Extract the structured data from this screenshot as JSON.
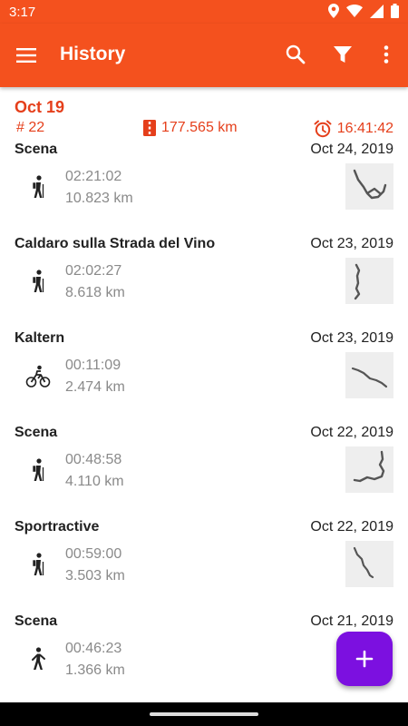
{
  "status_bar": {
    "time": "3:17",
    "icons": [
      "location-icon",
      "wifi-icon",
      "signal-icon",
      "battery-icon"
    ]
  },
  "app_bar": {
    "title": "History",
    "icons": [
      "menu-icon",
      "search-icon",
      "filter-icon",
      "more-vert-icon"
    ]
  },
  "summary": {
    "month": "Oct 19",
    "count_label": "# 22",
    "distance": "177.565 km",
    "duration": "16:41:42"
  },
  "activities": [
    {
      "name": "Scena",
      "date": "Oct 24, 2019",
      "duration": "02:21:02",
      "distance": "10.823 km",
      "type": "hiking-icon"
    },
    {
      "name": "Caldaro sulla Strada del Vino",
      "date": "Oct 23, 2019",
      "duration": "02:02:27",
      "distance": "8.618 km",
      "type": "hiking-icon"
    },
    {
      "name": "Kaltern",
      "date": "Oct 23, 2019",
      "duration": "00:11:09",
      "distance": "2.474 km",
      "type": "cycling-icon"
    },
    {
      "name": "Scena",
      "date": "Oct 22, 2019",
      "duration": "00:48:58",
      "distance": "4.110 km",
      "type": "hiking-icon"
    },
    {
      "name": "Sportractive",
      "date": "Oct 22, 2019",
      "duration": "00:59:00",
      "distance": "3.503 km",
      "type": "hiking-icon"
    },
    {
      "name": "Scena",
      "date": "Oct 21, 2019",
      "duration": "00:46:23",
      "distance": "1.366 km",
      "type": "walking-icon"
    }
  ],
  "fab": {
    "icon": "plus-icon"
  },
  "colors": {
    "primary": "#f4511e",
    "accent_text": "#e53f1b",
    "fab": "#7c10e0",
    "secondary_text": "#8a8a8a"
  }
}
